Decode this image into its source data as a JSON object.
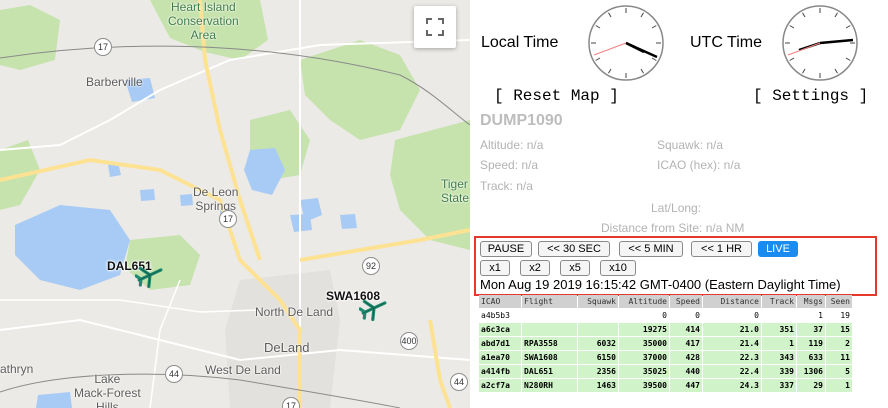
{
  "map": {
    "labels": {
      "heart_island": "Heart Island\nConservation\nArea",
      "barberville": "Barberville",
      "de_leon_springs": "De Leon\nSprings",
      "tiger_state": "Tiger\nState I",
      "north_de_land": "North De Land",
      "deland": "DeLand",
      "west_de_land": "West De Land",
      "lake_mack": "Lake\nMack-Forest\nHills",
      "kathryn": "athryn"
    },
    "shields": {
      "s17a": "17",
      "s17b": "17",
      "s17c": "17",
      "s92": "92",
      "s400": "400",
      "s44a": "44",
      "s44b": "44"
    },
    "planes": [
      {
        "callsign": "DAL651"
      },
      {
        "callsign": "SWA1608"
      }
    ],
    "colors": {
      "water": "#a8cbf5",
      "park": "#c6e2ad",
      "road": "#ffffff",
      "highway": "#fde293",
      "plane": "#1f8a6f"
    }
  },
  "clocks": {
    "local_label": "Local Time",
    "utc_label": "UTC Time"
  },
  "buttons": {
    "reset_map": "[ Reset Map ]",
    "settings": "[ Settings ]"
  },
  "selected": {
    "title": "DUMP1090",
    "altitude": "Altitude: n/a",
    "squawk": "Squawk: n/a",
    "speed": "Speed: n/a",
    "icao": "ICAO (hex): n/a",
    "track": "Track: n/a",
    "latlong": "Lat/Long:",
    "distance": "Distance from Site: n/a NM"
  },
  "controls": {
    "pause": "PAUSE",
    "back30s": "<< 30 SEC",
    "back5m": "<< 5 MIN",
    "back1h": "<< 1 HR",
    "live": "LIVE",
    "x1": "x1",
    "x2": "x2",
    "x5": "x5",
    "x10": "x10",
    "datetime": "Mon Aug 19 2019 16:15:42 GMT-0400 (Eastern Daylight Time)"
  },
  "table": {
    "headers": [
      "ICAO",
      "Flight",
      "Squawk",
      "Altitude",
      "Speed",
      "Distance",
      "Track",
      "Msgs",
      "Seen"
    ],
    "rows": [
      {
        "style": "plain",
        "cells": [
          "a4b5b3",
          "",
          "",
          "0",
          "0",
          "0",
          "",
          "1",
          "19"
        ]
      },
      {
        "style": "green",
        "cells": [
          "a6c3ca",
          "",
          "",
          "19275",
          "414",
          "21.0",
          "351",
          "37",
          "15"
        ]
      },
      {
        "style": "green",
        "cells": [
          "abd7d1",
          "RPA3558",
          "6032",
          "35000",
          "417",
          "21.4",
          "1",
          "119",
          "2"
        ]
      },
      {
        "style": "green",
        "cells": [
          "a1ea70",
          "SWA1608",
          "6150",
          "37000",
          "428",
          "22.3",
          "343",
          "633",
          "11"
        ]
      },
      {
        "style": "green",
        "cells": [
          "a414fb",
          "DAL651",
          "2356",
          "35025",
          "440",
          "22.4",
          "339",
          "1306",
          "5"
        ]
      },
      {
        "style": "green",
        "cells": [
          "a2cf7a",
          "N280RH",
          "1463",
          "39500",
          "447",
          "24.3",
          "337",
          "29",
          "1"
        ]
      }
    ]
  }
}
